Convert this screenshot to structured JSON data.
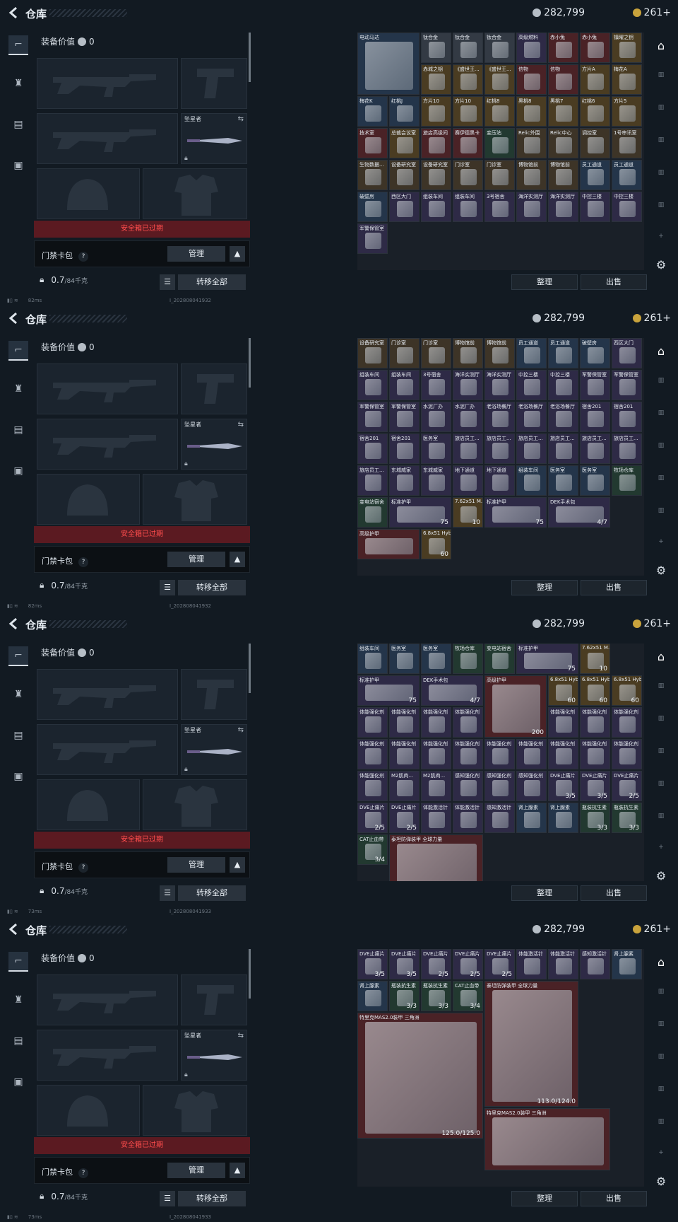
{
  "header": {
    "title": "仓库",
    "silver": "282,799",
    "gold": "261+"
  },
  "left": {
    "equip_value_label": "装备价值",
    "equip_value": "0",
    "melee_name": "坠星者",
    "warn": "安全箱已过期",
    "keybag": "门禁卡包",
    "help": "?",
    "manage": "管理",
    "weight": "0.7",
    "weight_max": "/84千克",
    "move_all": "转移全部"
  },
  "buttons": {
    "sort": "整理",
    "sell": "出售"
  },
  "frames": [
    {
      "ping": "82ms",
      "build": "I_202808041932",
      "cells": [
        {
          "n": "电动马达",
          "c": "c-blue",
          "w": 2,
          "h": 2
        },
        {
          "n": "钛合金",
          "c": "c-gray"
        },
        {
          "n": "钛合金",
          "c": "c-gray"
        },
        {
          "n": "钛合金",
          "c": "c-gray"
        },
        {
          "n": "高级燃料",
          "c": "c-purple"
        },
        {
          "n": "赤小兔",
          "c": "c-red"
        },
        {
          "n": "赤小兔",
          "c": "c-red"
        },
        {
          "n": "镇曜之钥",
          "c": "c-gold"
        },
        {
          "n": "赤城之钥",
          "c": "c-gold"
        },
        {
          "n": "《盛世王...",
          "c": "c-gold"
        },
        {
          "n": "《盛世王...",
          "c": "c-gold"
        },
        {
          "n": "信物",
          "c": "c-red"
        },
        {
          "n": "信物",
          "c": "c-red"
        },
        {
          "n": "方片A",
          "c": "c-gold"
        },
        {
          "n": "梅花A",
          "c": "c-gold"
        },
        {
          "n": "梅花K",
          "c": "c-blue"
        },
        {
          "n": "红桃J",
          "c": "c-blue"
        },
        {
          "n": "方片10",
          "c": "c-gold"
        },
        {
          "n": "方片10",
          "c": "c-gold"
        },
        {
          "n": "红桃8",
          "c": "c-gold"
        },
        {
          "n": "黑桃8",
          "c": "c-gold"
        },
        {
          "n": "黑桃7",
          "c": "c-gold"
        },
        {
          "n": "红桃6",
          "c": "c-gold"
        },
        {
          "n": "方片5",
          "c": "c-gold"
        },
        {
          "n": "技术室",
          "c": "c-red"
        },
        {
          "n": "总裁会议室",
          "c": "c-gold"
        },
        {
          "n": "旅店高级间",
          "c": "c-red"
        },
        {
          "n": "赛伊德黑卡",
          "c": "c-red"
        },
        {
          "n": "变压站",
          "c": "c-green"
        },
        {
          "n": "Relic外围",
          "c": "c-brown"
        },
        {
          "n": "Relic中心",
          "c": "c-brown"
        },
        {
          "n": "调控室",
          "c": "c-brown"
        },
        {
          "n": "1号审讯室",
          "c": "c-brown"
        },
        {
          "n": "生物数据...",
          "c": "c-brown"
        },
        {
          "n": "设备研究室",
          "c": "c-brown"
        },
        {
          "n": "设备研究室",
          "c": "c-brown"
        },
        {
          "n": "门诊室",
          "c": "c-brown"
        },
        {
          "n": "门诊室",
          "c": "c-brown"
        },
        {
          "n": "博物馆前",
          "c": "c-brown"
        },
        {
          "n": "博物馆前",
          "c": "c-brown"
        },
        {
          "n": "员工通道",
          "c": "c-blue"
        },
        {
          "n": "员工通道",
          "c": "c-blue"
        },
        {
          "n": "破壁房",
          "c": "c-blue"
        },
        {
          "n": "西区大门",
          "c": "c-purple"
        },
        {
          "n": "组装车间",
          "c": "c-purple"
        },
        {
          "n": "组装车间",
          "c": "c-purple"
        },
        {
          "n": "3号宿舍",
          "c": "c-purple"
        },
        {
          "n": "海洋实测厅",
          "c": "c-purple"
        },
        {
          "n": "海洋实测厅",
          "c": "c-purple"
        },
        {
          "n": "中控三楼",
          "c": "c-purple"
        },
        {
          "n": "中控三楼",
          "c": "c-purple"
        },
        {
          "n": "军警保管室",
          "c": "c-purple"
        }
      ]
    },
    {
      "ping": "82ms",
      "build": "I_202808041932",
      "cells": [
        {
          "n": "设备研究室",
          "c": "c-brown"
        },
        {
          "n": "门诊室",
          "c": "c-brown"
        },
        {
          "n": "门诊室",
          "c": "c-brown"
        },
        {
          "n": "博物馆前",
          "c": "c-brown"
        },
        {
          "n": "博物馆前",
          "c": "c-brown"
        },
        {
          "n": "员工通道",
          "c": "c-blue"
        },
        {
          "n": "员工通道",
          "c": "c-blue"
        },
        {
          "n": "破壁房",
          "c": "c-blue"
        },
        {
          "n": "西区大门",
          "c": "c-purple"
        },
        {
          "n": "组装车间",
          "c": "c-purple"
        },
        {
          "n": "组装车间",
          "c": "c-purple"
        },
        {
          "n": "3号宿舍",
          "c": "c-purple"
        },
        {
          "n": "海洋实测厅",
          "c": "c-purple"
        },
        {
          "n": "海洋实测厅",
          "c": "c-purple"
        },
        {
          "n": "中控三楼",
          "c": "c-purple"
        },
        {
          "n": "中控三楼",
          "c": "c-purple"
        },
        {
          "n": "军警保管室",
          "c": "c-purple"
        },
        {
          "n": "军警保管室",
          "c": "c-purple"
        },
        {
          "n": "军警保管室",
          "c": "c-purple"
        },
        {
          "n": "军警保管室",
          "c": "c-purple"
        },
        {
          "n": "水泥厂办",
          "c": "c-purple"
        },
        {
          "n": "水泥厂办",
          "c": "c-purple"
        },
        {
          "n": "老浴场餐厅",
          "c": "c-purple"
        },
        {
          "n": "老浴场餐厅",
          "c": "c-purple"
        },
        {
          "n": "老浴场餐厅",
          "c": "c-purple"
        },
        {
          "n": "宿舍201",
          "c": "c-purple"
        },
        {
          "n": "宿舍201",
          "c": "c-purple"
        },
        {
          "n": "宿舍201",
          "c": "c-purple"
        },
        {
          "n": "宿舍201",
          "c": "c-purple"
        },
        {
          "n": "医务室",
          "c": "c-purple"
        },
        {
          "n": "旅店员工...",
          "c": "c-purple"
        },
        {
          "n": "旅店员工...",
          "c": "c-purple"
        },
        {
          "n": "旅店员工...",
          "c": "c-purple"
        },
        {
          "n": "旅店员工...",
          "c": "c-purple"
        },
        {
          "n": "旅店员工...",
          "c": "c-purple"
        },
        {
          "n": "旅店员工...",
          "c": "c-purple"
        },
        {
          "n": "旅店员工...",
          "c": "c-purple"
        },
        {
          "n": "东城威家",
          "c": "c-purple"
        },
        {
          "n": "东城威家",
          "c": "c-purple"
        },
        {
          "n": "地下通道",
          "c": "c-purple"
        },
        {
          "n": "地下通道",
          "c": "c-purple"
        },
        {
          "n": "组装车间",
          "c": "c-blue"
        },
        {
          "n": "医务室",
          "c": "c-blue"
        },
        {
          "n": "医务室",
          "c": "c-blue"
        },
        {
          "n": "牧场仓库",
          "c": "c-green"
        },
        {
          "n": "变电站宿舍",
          "c": "c-green"
        },
        {
          "n": "标准护甲",
          "c": "c-purple",
          "w": 2,
          "ct": "75"
        },
        {
          "n": "7.62x51 M...",
          "c": "c-gold",
          "ct": "10"
        },
        {
          "n": "标准护甲",
          "c": "c-purple",
          "w": 2,
          "ct": "75"
        },
        {
          "n": "DEK手术包",
          "c": "c-purple",
          "w": 2,
          "ct": "4/7"
        },
        {
          "n": "高级护甲",
          "c": "c-red",
          "w": 2
        },
        {
          "n": "6.8x51 Hyb...",
          "c": "c-gold",
          "ct": "60"
        }
      ]
    },
    {
      "ping": "73ms",
      "build": "I_202808041933",
      "cells": [
        {
          "n": "组装车间",
          "c": "c-blue"
        },
        {
          "n": "医务室",
          "c": "c-blue"
        },
        {
          "n": "医务室",
          "c": "c-blue"
        },
        {
          "n": "牧场仓库",
          "c": "c-green"
        },
        {
          "n": "变电站宿舍",
          "c": "c-green"
        },
        {
          "n": "标准护甲",
          "c": "c-purple",
          "w": 2,
          "ct": "75"
        },
        {
          "n": "7.62x51 M...",
          "c": "c-gold",
          "ct": "10"
        },
        {
          "n": "标准护甲",
          "c": "c-purple",
          "w": 2,
          "ct": "75"
        },
        {
          "n": "DEK手术包",
          "c": "c-purple",
          "w": 2,
          "ct": "4/7"
        },
        {
          "n": "高级护甲",
          "c": "c-red",
          "w": 2,
          "h": 2,
          "ct": "200"
        },
        {
          "n": "6.8x51 Hyb...",
          "c": "c-gold",
          "ct": "60"
        },
        {
          "n": "6.8x51 Hyb...",
          "c": "c-gold",
          "ct": "60"
        },
        {
          "n": "6.8x51 Hyb...",
          "c": "c-gold",
          "ct": "60"
        },
        {
          "n": "体能强化剂",
          "c": "c-purple"
        },
        {
          "n": "体能强化剂",
          "c": "c-purple"
        },
        {
          "n": "体能强化剂",
          "c": "c-purple"
        },
        {
          "n": "体能强化剂",
          "c": "c-purple"
        },
        {
          "n": "体能强化剂",
          "c": "c-purple"
        },
        {
          "n": "体能强化剂",
          "c": "c-purple"
        },
        {
          "n": "体能强化剂",
          "c": "c-purple"
        },
        {
          "n": "体能强化剂",
          "c": "c-purple"
        },
        {
          "n": "体能强化剂",
          "c": "c-purple"
        },
        {
          "n": "体能强化剂",
          "c": "c-purple"
        },
        {
          "n": "体能强化剂",
          "c": "c-purple"
        },
        {
          "n": "体能强化剂",
          "c": "c-purple"
        },
        {
          "n": "体能强化剂",
          "c": "c-purple"
        },
        {
          "n": "体能强化剂",
          "c": "c-purple"
        },
        {
          "n": "体能强化剂",
          "c": "c-purple"
        },
        {
          "n": "体能强化剂",
          "c": "c-purple"
        },
        {
          "n": "体能强化剂",
          "c": "c-purple"
        },
        {
          "n": "M2肌肉...",
          "c": "c-purple"
        },
        {
          "n": "M2肌肉...",
          "c": "c-purple"
        },
        {
          "n": "感知强化剂",
          "c": "c-purple"
        },
        {
          "n": "感知强化剂",
          "c": "c-purple"
        },
        {
          "n": "感知强化剂",
          "c": "c-purple"
        },
        {
          "n": "DVE止痛片",
          "c": "c-purple",
          "ct": "3/5"
        },
        {
          "n": "DVE止痛片",
          "c": "c-purple",
          "ct": "3/5"
        },
        {
          "n": "DVE止痛片",
          "c": "c-purple",
          "ct": "2/5"
        },
        {
          "n": "DVE止痛片",
          "c": "c-purple",
          "ct": "2/5"
        },
        {
          "n": "DVE止痛片",
          "c": "c-purple",
          "ct": "2/5"
        },
        {
          "n": "体能激活针",
          "c": "c-purple"
        },
        {
          "n": "体能激活针",
          "c": "c-purple"
        },
        {
          "n": "感知激活针",
          "c": "c-purple"
        },
        {
          "n": "肾上腺素",
          "c": "c-blue"
        },
        {
          "n": "肾上腺素",
          "c": "c-blue"
        },
        {
          "n": "瓶装抗生素",
          "c": "c-green",
          "ct": "3/3"
        },
        {
          "n": "瓶装抗生素",
          "c": "c-green",
          "ct": "3/3"
        },
        {
          "n": "CAT止血带",
          "c": "c-green",
          "ct": "3/4"
        },
        {
          "n": "泰坦防弹装甲 全球力量",
          "c": "c-red",
          "w": 3,
          "h": 2
        }
      ]
    },
    {
      "ping": "73ms",
      "build": "I_202808041933",
      "cells": [
        {
          "n": "DVE止痛片",
          "c": "c-purple",
          "ct": "3/5"
        },
        {
          "n": "DVE止痛片",
          "c": "c-purple",
          "ct": "3/5"
        },
        {
          "n": "DVE止痛片",
          "c": "c-purple",
          "ct": "2/5"
        },
        {
          "n": "DVE止痛片",
          "c": "c-purple",
          "ct": "2/5"
        },
        {
          "n": "DVE止痛片",
          "c": "c-purple",
          "ct": "2/5"
        },
        {
          "n": "体能激活针",
          "c": "c-purple"
        },
        {
          "n": "体能激活针",
          "c": "c-purple"
        },
        {
          "n": "感知激活针",
          "c": "c-purple"
        },
        {
          "n": "肾上腺素",
          "c": "c-blue"
        },
        {
          "n": "肾上腺素",
          "c": "c-blue"
        },
        {
          "n": "瓶装抗生素",
          "c": "c-green",
          "ct": "3/3"
        },
        {
          "n": "瓶装抗生素",
          "c": "c-green",
          "ct": "3/3"
        },
        {
          "n": "CAT止血带",
          "c": "c-green",
          "ct": "3/4"
        },
        {
          "n": "泰坦防弹装甲 全球力量",
          "c": "c-red",
          "w": 3,
          "h": 4,
          "ct": "113.0/124.0"
        },
        {
          "n": "特里克MAS2.0装甲 三角洲",
          "c": "c-red",
          "w": 4,
          "h": 4,
          "ct": "125.0/125.0"
        },
        {
          "n": "特里克MAS2.0装甲 三角洲",
          "c": "c-red",
          "w": 4,
          "h": 2
        }
      ]
    }
  ]
}
